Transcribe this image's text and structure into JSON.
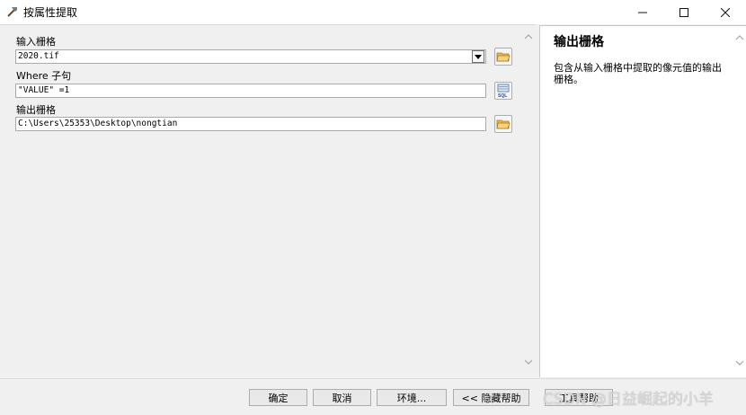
{
  "window": {
    "title": "按属性提取"
  },
  "form": {
    "input_raster": {
      "label": "输入栅格",
      "value": "2020.tif"
    },
    "where_clause": {
      "label": "Where 子句",
      "value": "\"VALUE\" =1"
    },
    "output_raster": {
      "label": "输出栅格",
      "value": "C:\\Users\\25353\\Desktop\\nongtian"
    }
  },
  "help": {
    "title": "输出栅格",
    "body": "包含从输入栅格中提取的像元值的输出栅格。"
  },
  "buttons": {
    "ok": "确定",
    "cancel": "取消",
    "environments": "环境...",
    "hide_help": "<< 隐藏帮助",
    "tool_help": "工具帮助"
  },
  "watermark": "CSDN @日益崛起的小羊",
  "icons": {
    "app": "pick-hammer-icon",
    "browse": "open-folder-icon",
    "sql": "sql-query-icon"
  }
}
